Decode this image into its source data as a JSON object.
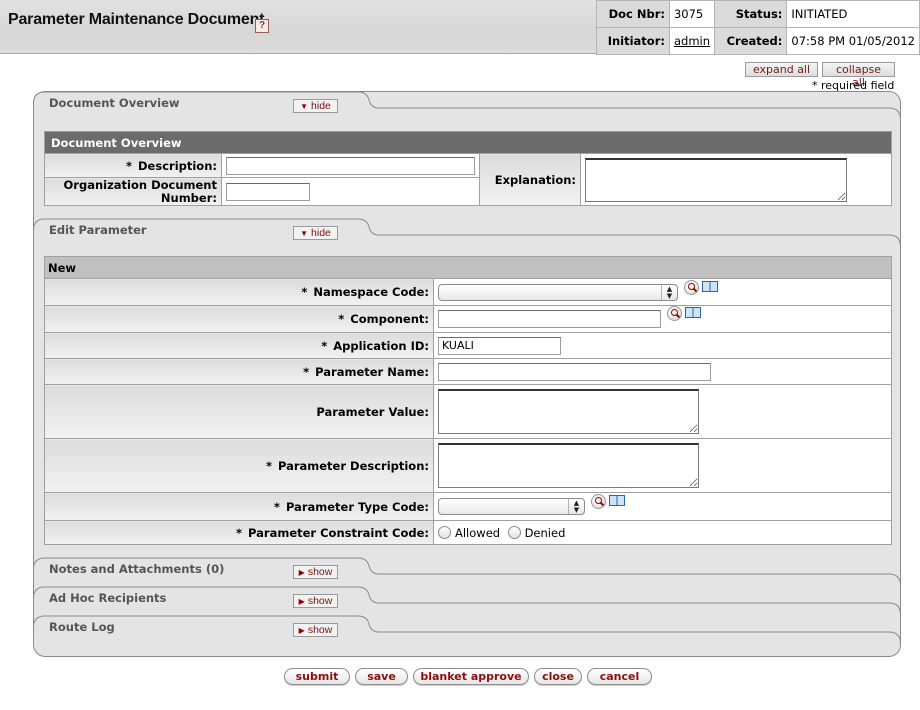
{
  "header": {
    "title": "Parameter Maintenance Document",
    "help_icon": "?",
    "doc_info": {
      "doc_nbr_label": "Doc Nbr:",
      "doc_nbr": "3075",
      "status_label": "Status:",
      "status": "INITIATED",
      "initiator_label": "Initiator:",
      "initiator": "admin",
      "created_label": "Created:",
      "created": "07:58 PM 01/05/2012"
    }
  },
  "controls": {
    "expand_all": "expand all",
    "collapse_all": "collapse all",
    "required_note": "* required field"
  },
  "sections": {
    "document_overview": {
      "tab_title": "Document Overview",
      "toggle": "hide",
      "header": "Document Overview",
      "description_label": "Description:",
      "description_value": "",
      "org_doc_number_label_1": "Organization Document",
      "org_doc_number_label_2": "Number:",
      "org_doc_number_value": "",
      "explanation_label": "Explanation:",
      "explanation_value": ""
    },
    "edit_parameter": {
      "tab_title": "Edit Parameter",
      "toggle": "hide",
      "header": "New",
      "fields": {
        "namespace_code": {
          "label": "Namespace Code:",
          "required": "*",
          "value": ""
        },
        "component": {
          "label": "Component:",
          "required": "*",
          "value": ""
        },
        "application_id": {
          "label": "Application ID:",
          "required": "*",
          "value": "KUALI"
        },
        "parameter_name": {
          "label": "Parameter Name:",
          "required": "*",
          "value": ""
        },
        "parameter_value": {
          "label": "Parameter Value:",
          "value": ""
        },
        "parameter_description": {
          "label": "Parameter Description:",
          "required": "*",
          "value": ""
        },
        "parameter_type_code": {
          "label": "Parameter Type Code:",
          "required": "*",
          "value": ""
        },
        "parameter_constraint_code": {
          "label": "Parameter Constraint Code:",
          "required": "*",
          "options": [
            "Allowed",
            "Denied"
          ]
        }
      }
    },
    "notes": {
      "tab_title": "Notes and Attachments (0)",
      "toggle": "show"
    },
    "adhoc": {
      "tab_title": "Ad Hoc Recipients",
      "toggle": "show"
    },
    "route_log": {
      "tab_title": "Route Log",
      "toggle": "show"
    }
  },
  "actions": {
    "submit": "submit",
    "save": "save",
    "blanket_approve": "blanket approve",
    "close": "close",
    "cancel": "cancel"
  }
}
